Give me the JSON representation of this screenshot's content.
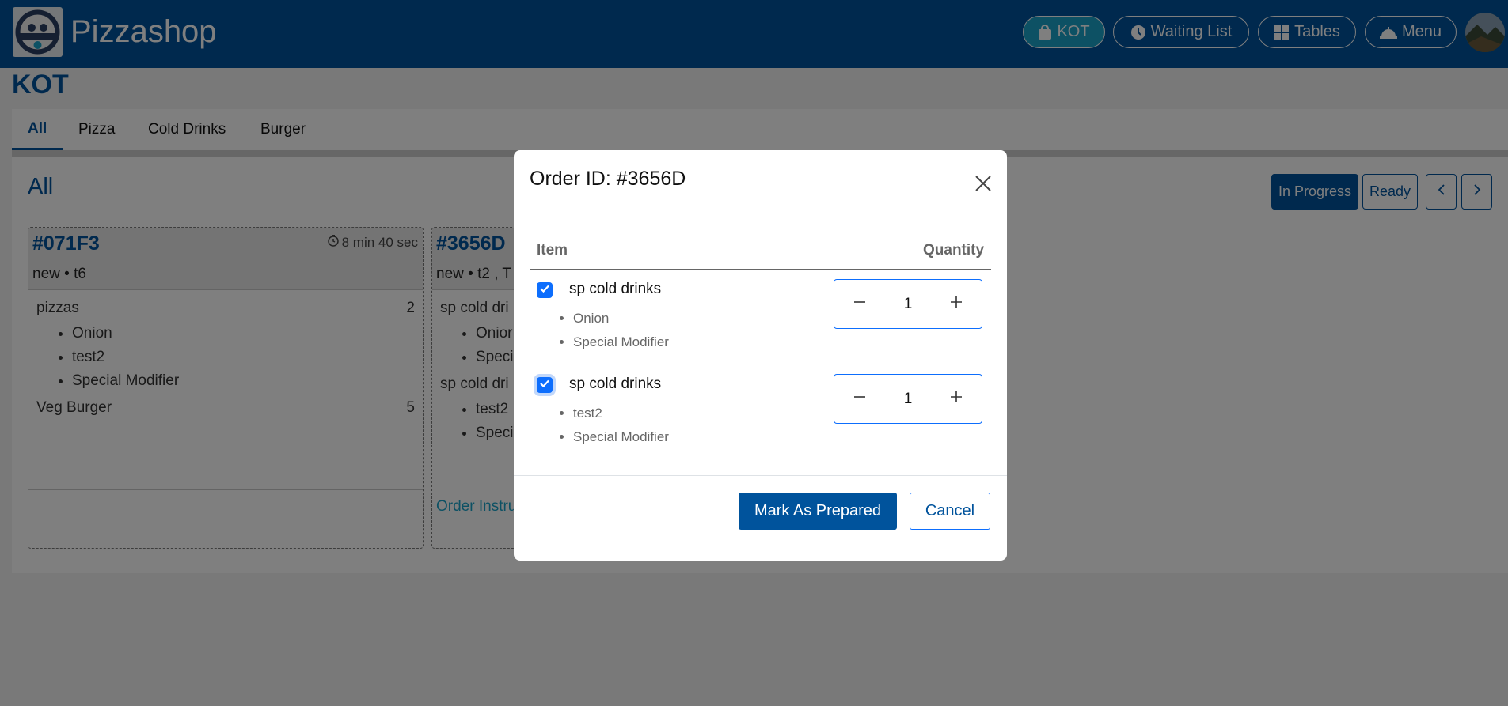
{
  "header": {
    "brand": "Pizzashop",
    "logo_text": "PIZZASHOP",
    "nav": [
      {
        "label": "KOT",
        "icon": "bag-icon",
        "active": true
      },
      {
        "label": "Waiting List",
        "icon": "clock-icon",
        "active": false
      },
      {
        "label": "Tables",
        "icon": "grid-icon",
        "active": false
      },
      {
        "label": "Menu",
        "icon": "bell-icon",
        "active": false
      }
    ]
  },
  "page": {
    "title": "KOT"
  },
  "tabs": [
    {
      "label": "All",
      "active": true
    },
    {
      "label": "Pizza",
      "active": false
    },
    {
      "label": "Cold Drinks",
      "active": false
    },
    {
      "label": "Burger",
      "active": false
    }
  ],
  "section": {
    "title": "All",
    "in_progress_label": "In Progress",
    "ready_label": "Ready"
  },
  "cards": [
    {
      "id": "#071F3",
      "timer": "8 min 40 sec",
      "sub": "new • t6",
      "items": [
        {
          "name": "pizzas",
          "qty": "2",
          "mods": [
            "Onion",
            "test2",
            "Special Modifier"
          ]
        },
        {
          "name": "Veg Burger",
          "qty": "5",
          "mods": []
        }
      ]
    },
    {
      "id": "#3656D",
      "sub": "new • t2 , T",
      "items": [
        {
          "name": "sp cold dri",
          "mods": [
            "Onior",
            "Speci"
          ]
        },
        {
          "name": "sp cold dri",
          "mods": [
            "test2",
            "Speci"
          ]
        }
      ],
      "link": "Order Instru"
    }
  ],
  "modal": {
    "title": "Order ID: #3656D",
    "col_item": "Item",
    "col_qty": "Quantity",
    "rows": [
      {
        "name": "sp cold drinks",
        "checked": true,
        "qty": "1",
        "mods": [
          "Onion",
          "Special Modifier"
        ]
      },
      {
        "name": "sp cold drinks",
        "checked": true,
        "qty": "1",
        "mods": [
          "test2",
          "Special Modifier"
        ]
      }
    ],
    "primary_label": "Mark As Prepared",
    "cancel_label": "Cancel"
  },
  "colors": {
    "brand": "#00539c",
    "accent": "#1aa3c9",
    "checkbox": "#0d6efd"
  }
}
